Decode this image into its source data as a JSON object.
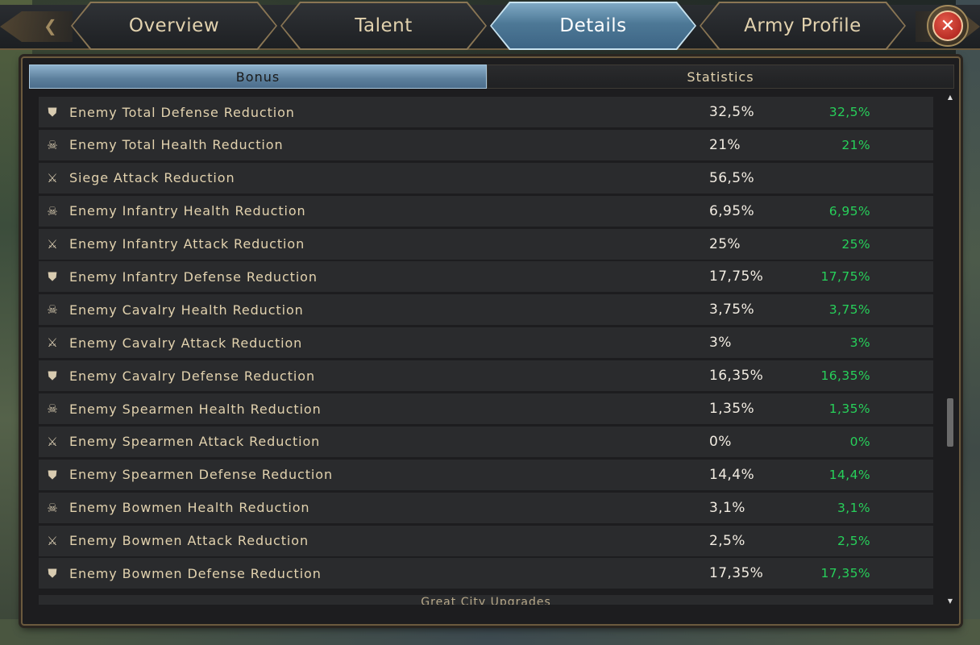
{
  "tabs": [
    {
      "label": "Overview",
      "active": false
    },
    {
      "label": "Talent",
      "active": false
    },
    {
      "label": "Details",
      "active": true
    },
    {
      "label": "Army Profile",
      "active": false
    }
  ],
  "close_icon": "close-icon",
  "subtabs": [
    {
      "label": "Bonus",
      "active": true
    },
    {
      "label": "Statistics",
      "active": false
    }
  ],
  "rows": [
    {
      "icon": "shield-icon",
      "name": "Enemy Total Defense Reduction",
      "value": "32,5%",
      "bonus": "32,5%"
    },
    {
      "icon": "skull-icon",
      "name": "Enemy Total Health Reduction",
      "value": "21%",
      "bonus": "21%"
    },
    {
      "icon": "catapult-icon",
      "name": "Siege Attack Reduction",
      "value": "56,5%",
      "bonus": ""
    },
    {
      "icon": "skull-icon",
      "name": "Enemy Infantry Health Reduction",
      "value": "6,95%",
      "bonus": "6,95%"
    },
    {
      "icon": "sword-icon",
      "name": "Enemy Infantry Attack Reduction",
      "value": "25%",
      "bonus": "25%"
    },
    {
      "icon": "shield-icon",
      "name": "Enemy Infantry Defense Reduction",
      "value": "17,75%",
      "bonus": "17,75%"
    },
    {
      "icon": "skull-icon",
      "name": "Enemy Cavalry Health Reduction",
      "value": "3,75%",
      "bonus": "3,75%"
    },
    {
      "icon": "sword-icon",
      "name": "Enemy Cavalry Attack Reduction",
      "value": "3%",
      "bonus": "3%"
    },
    {
      "icon": "shield-icon",
      "name": "Enemy Cavalry Defense Reduction",
      "value": "16,35%",
      "bonus": "16,35%"
    },
    {
      "icon": "skull-icon",
      "name": "Enemy Spearmen Health Reduction",
      "value": "1,35%",
      "bonus": "1,35%"
    },
    {
      "icon": "sword-icon",
      "name": "Enemy Spearmen Attack Reduction",
      "value": "0%",
      "bonus": "0%"
    },
    {
      "icon": "shield-icon",
      "name": "Enemy Spearmen Defense Reduction",
      "value": "14,4%",
      "bonus": "14,4%"
    },
    {
      "icon": "skull-icon",
      "name": "Enemy Bowmen Health Reduction",
      "value": "3,1%",
      "bonus": "3,1%"
    },
    {
      "icon": "sword-icon",
      "name": "Enemy Bowmen Attack Reduction",
      "value": "2,5%",
      "bonus": "2,5%"
    },
    {
      "icon": "shield-icon",
      "name": "Enemy Bowmen Defense Reduction",
      "value": "17,35%",
      "bonus": "17,35%"
    }
  ],
  "footer_section_label": "Great City Upgrades",
  "colors": {
    "bonus_green": "#27d05a",
    "active_tab": "#4d7896",
    "label_gold": "#e2d2ae"
  }
}
